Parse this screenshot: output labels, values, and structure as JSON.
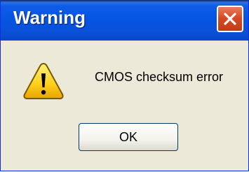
{
  "dialog": {
    "title": "Warning",
    "message": "CMOS checksum error",
    "ok_label": "OK",
    "icon": "warning-icon",
    "close_icon": "close-icon"
  },
  "colors": {
    "titlebar": "#0554e2",
    "close_button": "#d64b25",
    "body_background": "#ece9d8",
    "warning_fill": "#ffd21f",
    "button_border": "#003c74"
  }
}
